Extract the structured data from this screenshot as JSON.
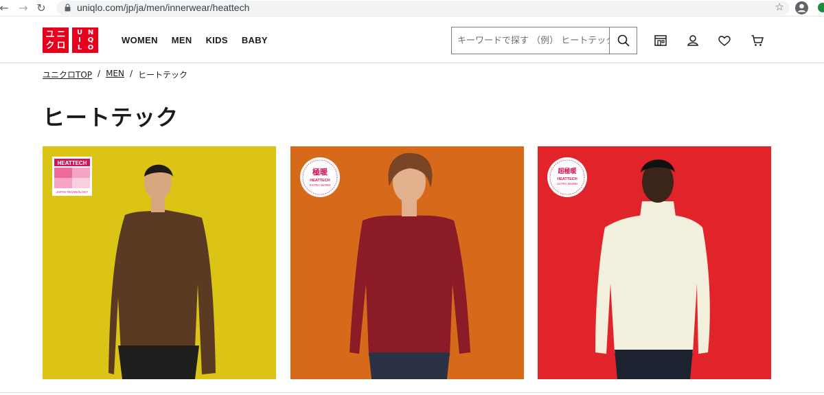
{
  "browser": {
    "url": "uniqlo.com/jp/ja/men/innerwear/heattech"
  },
  "header": {
    "logo": {
      "tile1": [
        "ユ",
        "ニ",
        "ク",
        "ロ"
      ],
      "tile2": [
        "U",
        "N",
        "I",
        "Q",
        "L",
        "O"
      ]
    },
    "nav": [
      "WOMEN",
      "MEN",
      "KIDS",
      "BABY"
    ],
    "search_placeholder": "キーワードで探す （例） ヒートテック"
  },
  "breadcrumb": {
    "home": "ユニクロTOP",
    "separator": "/",
    "parent": "MEN",
    "current": "ヒートテック"
  },
  "page_title": "ヒートテック",
  "tiles": [
    {
      "badge_label": "HEATTECH",
      "badge_sub": "JAPAN TECHNOLOGY",
      "background": "#dcc416",
      "garment_color": "#5a3a22"
    },
    {
      "badge_kanji": "極暖",
      "badge_label": "HEATTECH",
      "badge_sub": "EXTRA WARM",
      "background": "#d66a1a",
      "garment_color": "#8c1b28"
    },
    {
      "badge_kanji": "超極暖",
      "badge_label": "HEATTECH",
      "badge_sub": "ULTRA WARM",
      "background": "#e0242a",
      "garment_color": "#f3efdd"
    }
  ],
  "colors": {
    "brand_red": "#e8001d",
    "text": "#1b1b1b"
  }
}
